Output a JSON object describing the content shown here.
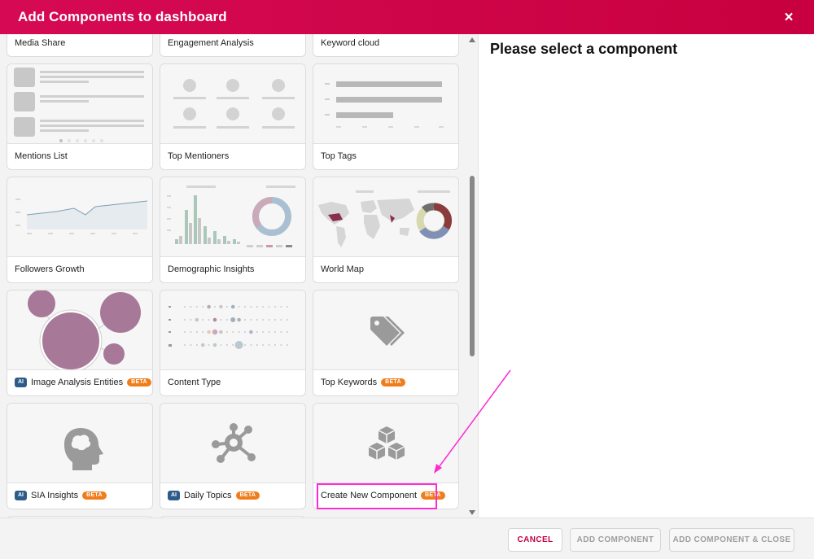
{
  "dialog": {
    "title": "Add Components to dashboard",
    "close_label": "×"
  },
  "components": [
    {
      "label": "Media Share"
    },
    {
      "label": "Engagement Analysis"
    },
    {
      "label": "Keyword cloud"
    },
    {
      "label": "Mentions List"
    },
    {
      "label": "Top Mentioners"
    },
    {
      "label": "Top Tags"
    },
    {
      "label": "Followers Growth"
    },
    {
      "label": "Demographic Insights"
    },
    {
      "label": "World Map"
    },
    {
      "label": "Image Analysis Entities",
      "ai": "AI",
      "beta": "BETA"
    },
    {
      "label": "Content Type"
    },
    {
      "label": "Top Keywords",
      "beta": "BETA"
    },
    {
      "label": "SIA Insights",
      "ai": "AI",
      "beta": "BETA"
    },
    {
      "label": "Daily Topics",
      "ai": "AI",
      "beta": "BETA"
    },
    {
      "label": "Create New Component",
      "beta": "BETA"
    }
  ],
  "detail_panel": {
    "title": "Please select a component"
  },
  "footer": {
    "cancel_label": "CANCEL",
    "add_label": "ADD COMPONENT",
    "add_close_label": "ADD COMPONENT & CLOSE"
  },
  "colors": {
    "header": "#d60a54",
    "accent_magenta": "#ff2ad4",
    "beta_badge": "#f07d1c",
    "ai_badge": "#2d5b8a",
    "bubble": "#a87898"
  },
  "icons": {
    "close": "close-icon",
    "tag": "tag-icon",
    "head": "brain-head-icon",
    "network": "network-hub-icon",
    "cubes": "cubes-icon"
  }
}
